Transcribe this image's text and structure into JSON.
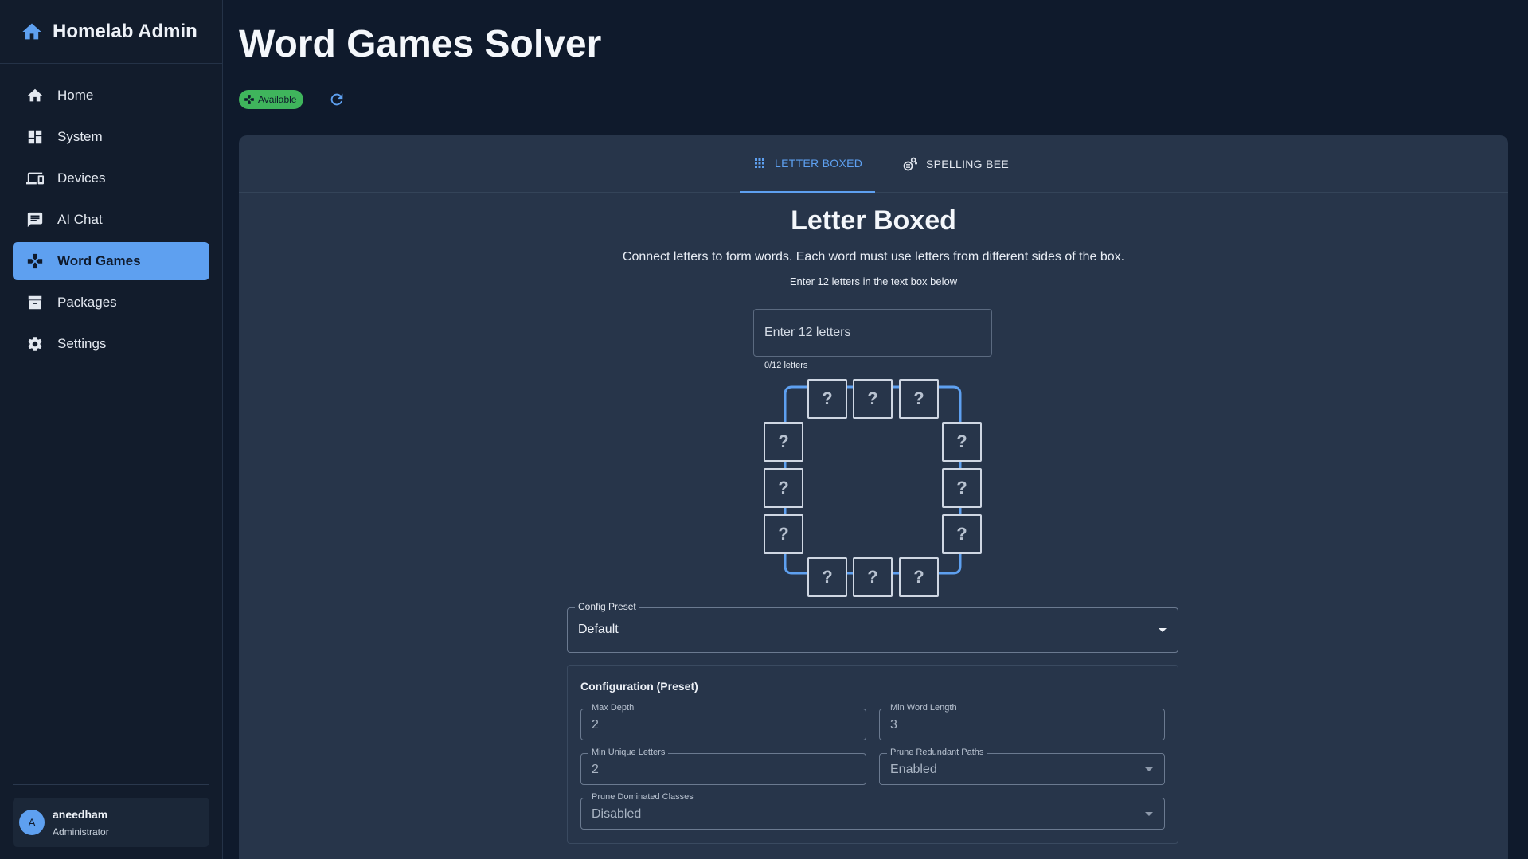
{
  "sidebar": {
    "brand": "Homelab Admin",
    "items": [
      {
        "label": "Home",
        "icon": "home-icon"
      },
      {
        "label": "System",
        "icon": "dashboard-icon"
      },
      {
        "label": "Devices",
        "icon": "devices-icon"
      },
      {
        "label": "AI Chat",
        "icon": "chat-icon"
      },
      {
        "label": "Word Games",
        "icon": "gamepad-icon",
        "active": true
      },
      {
        "label": "Packages",
        "icon": "archive-icon"
      },
      {
        "label": "Settings",
        "icon": "gear-icon"
      }
    ],
    "user": {
      "initial": "A",
      "name": "aneedham",
      "role": "Administrator"
    }
  },
  "header": {
    "title": "Word Games Solver",
    "status": "Available"
  },
  "tabs": [
    {
      "label": "LETTER BOXED",
      "icon": "grid-icon",
      "active": true
    },
    {
      "label": "SPELLING BEE",
      "icon": "bee-icon",
      "active": false
    }
  ],
  "game": {
    "title": "Letter Boxed",
    "description": "Connect letters to form words. Each word must use letters from different sides of the box.",
    "hint": "Enter 12 letters in the text box below",
    "input_placeholder": "Enter 12 letters",
    "input_value": "",
    "letter_count": "0/12 letters",
    "slot_placeholder": "?"
  },
  "config": {
    "preset_label": "Config Preset",
    "preset_value": "Default",
    "section_title": "Configuration (Preset)",
    "fields": {
      "max_depth": {
        "label": "Max Depth",
        "value": "2"
      },
      "min_word_length": {
        "label": "Min Word Length",
        "value": "3"
      },
      "min_unique_letters": {
        "label": "Min Unique Letters",
        "value": "2"
      },
      "prune_redundant_paths": {
        "label": "Prune Redundant Paths",
        "value": "Enabled"
      },
      "prune_dominated_classes": {
        "label": "Prune Dominated Classes",
        "value": "Disabled"
      }
    }
  },
  "colors": {
    "accent": "#5ea0f0",
    "status_green": "#3fb55c",
    "background": "#0f1a2c",
    "card": "#27354a"
  }
}
